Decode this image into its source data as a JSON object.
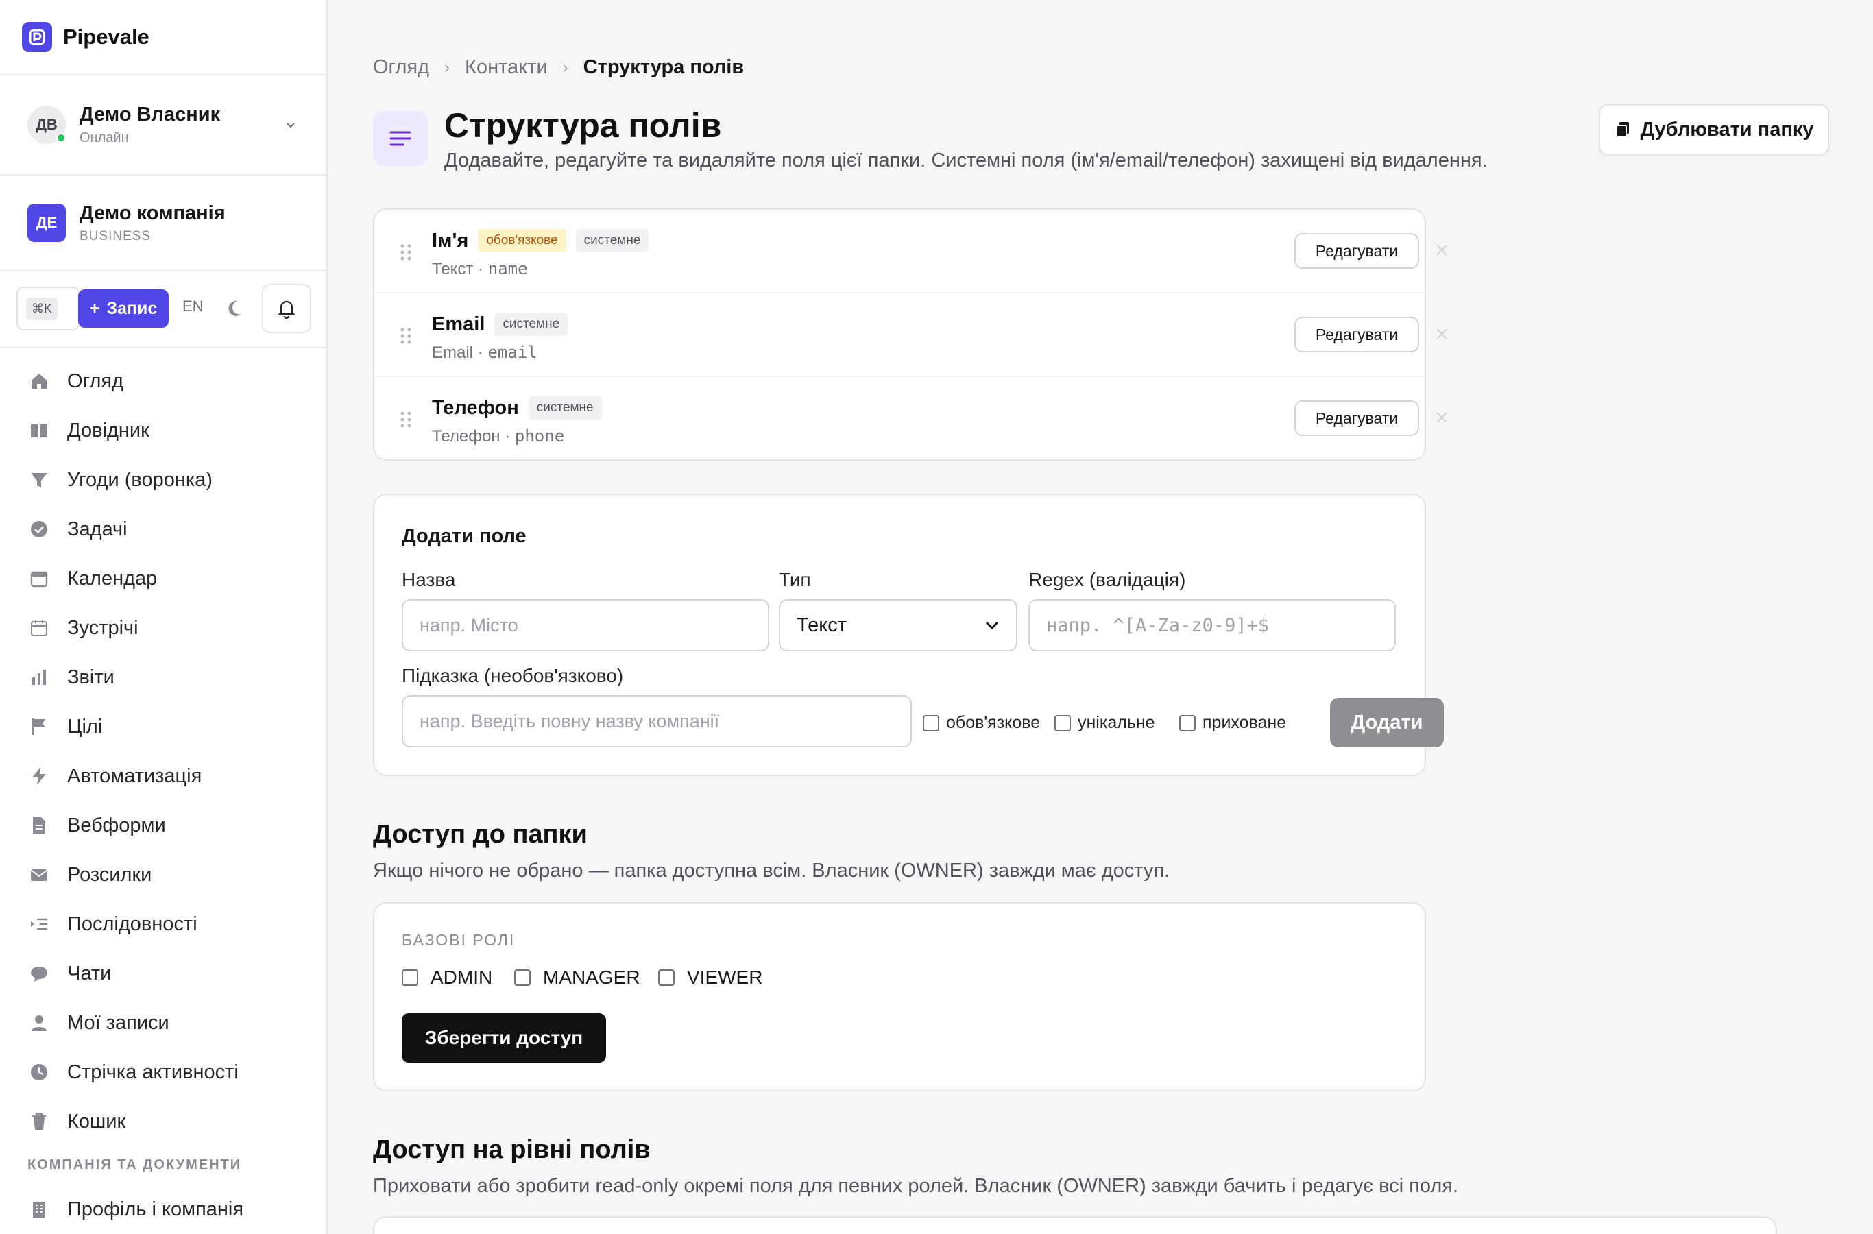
{
  "brand": {
    "name": "Pipevale"
  },
  "user": {
    "initials": "ДВ",
    "name": "Демо Власник",
    "status": "Онлайн"
  },
  "company": {
    "initials": "ДЕ",
    "name": "Демо компанія",
    "plan": "BUSINESS"
  },
  "toolbar": {
    "shortcut": "⌘K",
    "add_label": "Запис",
    "lang": "EN"
  },
  "nav": {
    "items": [
      {
        "label": "Огляд",
        "icon": "home-icon"
      },
      {
        "label": "Довідник",
        "icon": "book-icon"
      },
      {
        "label": "Угоди (воронка)",
        "icon": "funnel-icon"
      },
      {
        "label": "Задачі",
        "icon": "check-circle-icon"
      },
      {
        "label": "Календар",
        "icon": "calendar-icon"
      },
      {
        "label": "Зустрічі",
        "icon": "calendar-outline-icon"
      },
      {
        "label": "Звіти",
        "icon": "bar-chart-icon"
      },
      {
        "label": "Цілі",
        "icon": "flag-icon"
      },
      {
        "label": "Автоматизація",
        "icon": "bolt-icon"
      },
      {
        "label": "Вебформи",
        "icon": "document-icon"
      },
      {
        "label": "Розсилки",
        "icon": "mail-icon"
      },
      {
        "label": "Послідовності",
        "icon": "list-indent-icon"
      },
      {
        "label": "Чати",
        "icon": "chat-icon"
      },
      {
        "label": "Мої записи",
        "icon": "user-icon"
      },
      {
        "label": "Стрічка активності",
        "icon": "clock-icon"
      },
      {
        "label": "Кошик",
        "icon": "trash-icon"
      }
    ],
    "section_title": "КОМПАНІЯ ТА ДОКУМЕНТИ",
    "section_items": [
      {
        "label": "Профіль і компанія",
        "icon": "building-icon"
      }
    ]
  },
  "breadcrumb": {
    "items": [
      "Огляд",
      "Контакти"
    ],
    "current": "Структура полів"
  },
  "page": {
    "title": "Структура полів",
    "subtitle": "Додавайте, редагуйте та видаляйте поля цієї папки. Системні поля (ім'я/email/телефон) захищені від видалення.",
    "duplicate_label": "Дублювати папку"
  },
  "fields": [
    {
      "name": "Ім'я",
      "badges": [
        "обов'язкове",
        "системне"
      ],
      "type": "Текст",
      "key": "name",
      "edit_label": "Редагувати"
    },
    {
      "name": "Email",
      "badges": [
        "системне"
      ],
      "type": "Email",
      "key": "email",
      "edit_label": "Редагувати"
    },
    {
      "name": "Телефон",
      "badges": [
        "системне"
      ],
      "type": "Телефон",
      "key": "phone",
      "edit_label": "Редагувати"
    }
  ],
  "add_field": {
    "title": "Додати поле",
    "name_label": "Назва",
    "name_placeholder": "напр. Місто",
    "type_label": "Тип",
    "type_value": "Текст",
    "regex_label": "Regex (валідація)",
    "regex_placeholder": "напр. ^[A-Za-z0-9]+$",
    "hint_label": "Підказка (необов'язково)",
    "hint_placeholder": "напр. Введіть повну назву компанії",
    "options": [
      "обов'язкове",
      "унікальне",
      "приховане"
    ],
    "submit_label": "Додати"
  },
  "folder_access": {
    "title": "Доступ до папки",
    "subtitle": "Якщо нічого не обрано — папка доступна всім. Власник (OWNER) завжди має доступ.",
    "roles_label": "БАЗОВІ РОЛІ",
    "roles": [
      "ADMIN",
      "MANAGER",
      "VIEWER"
    ],
    "save_label": "Зберегти доступ"
  },
  "field_access": {
    "title": "Доступ на рівні полів",
    "subtitle": "Приховати або зробити read-only окремі поля для певних ролей. Власник (OWNER) завжди бачить і редагує всі поля."
  },
  "colors": {
    "accent": "#4f46e5",
    "required_badge_bg": "#fef3c7",
    "required_badge_text": "#b45309",
    "online": "#22c55e"
  }
}
